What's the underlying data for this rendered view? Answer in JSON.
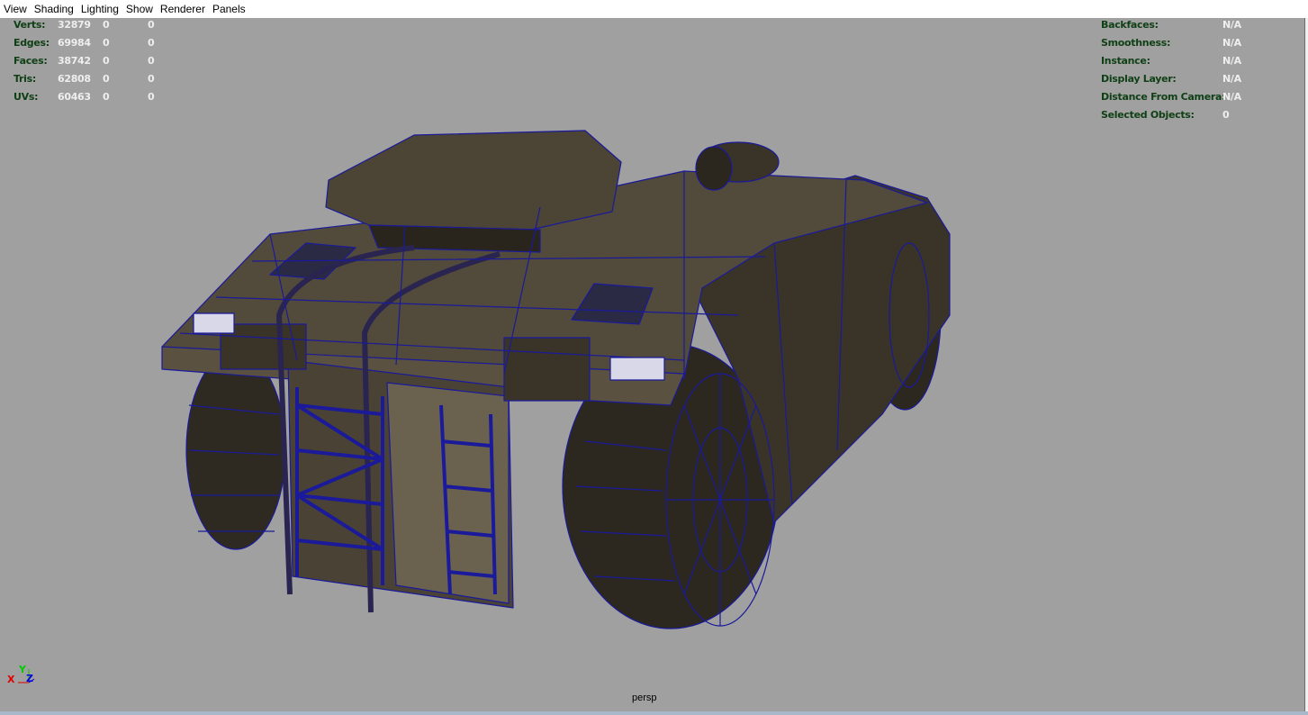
{
  "menu": [
    "View",
    "Shading",
    "Lighting",
    "Show",
    "Renderer",
    "Panels"
  ],
  "stats": [
    {
      "label": "Verts:",
      "value": "32879",
      "a": "0",
      "b": "0"
    },
    {
      "label": "Edges:",
      "value": "69984",
      "a": "0",
      "b": "0"
    },
    {
      "label": "Faces:",
      "value": "38742",
      "a": "0",
      "b": "0"
    },
    {
      "label": "Tris:",
      "value": "62808",
      "a": "0",
      "b": "0"
    },
    {
      "label": "UVs:",
      "value": "60463",
      "a": "0",
      "b": "0"
    }
  ],
  "info": [
    {
      "label": "Backfaces:",
      "value": "N/A"
    },
    {
      "label": "Smoothness:",
      "value": "N/A"
    },
    {
      "label": "Instance:",
      "value": "N/A"
    },
    {
      "label": "Display Layer:",
      "value": "N/A"
    },
    {
      "label": "Distance From Camera:",
      "value": "N/A"
    },
    {
      "label": "Selected Objects:",
      "value": "0"
    }
  ],
  "camera": "persp",
  "axes": {
    "x": "X",
    "y": "Y",
    "z": "Z"
  },
  "colors": {
    "background": "#a0a0a0",
    "wire": "#1a1a9a",
    "mesh": "#3d3628"
  }
}
